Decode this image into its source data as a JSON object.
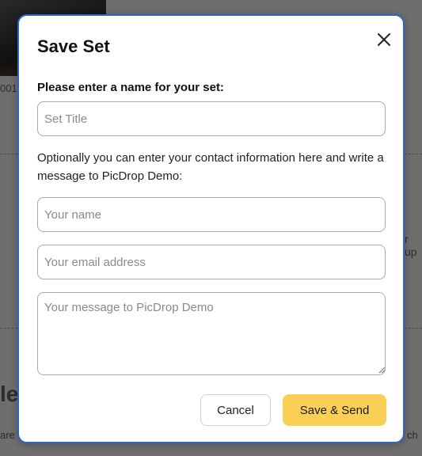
{
  "background": {
    "fragment_left": "001",
    "fragment_right": "r up",
    "fragment_heading": "le",
    "fragment_bottom_left": "are",
    "fragment_bottom_right": "ch"
  },
  "modal": {
    "title": "Save Set",
    "close_icon": "close-icon",
    "name_label": "Please enter a name for your set:",
    "title_placeholder": "Set Title",
    "info_text": "Optionally you can enter your contact information here and write a message to PicDrop Demo:",
    "name_placeholder": "Your name",
    "email_placeholder": "Your email address",
    "message_placeholder": "Your message to PicDrop Demo",
    "cancel_label": "Cancel",
    "save_label": "Save & Send"
  },
  "colors": {
    "accent_border": "#2e63c9",
    "primary_button": "#f9cf55",
    "overlay": "#6e6e6e"
  }
}
